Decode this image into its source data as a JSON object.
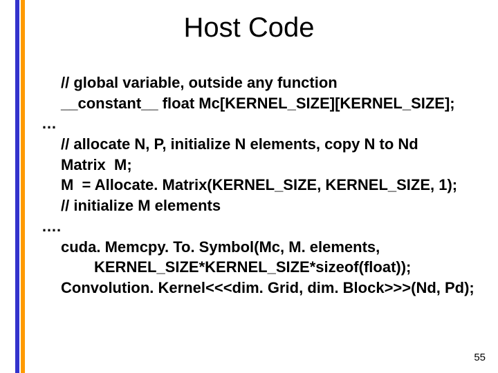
{
  "title": "Host Code",
  "lines": {
    "l1": "// global variable, outside any function",
    "l2": "__constant__ float Mc[KERNEL_SIZE][KERNEL_SIZE];",
    "l3": "…",
    "l4": "// allocate N, P, initialize N elements, copy N to Nd",
    "l5": "Matrix  M;",
    "l6": "M  = Allocate. Matrix(KERNEL_SIZE, KERNEL_SIZE, 1);",
    "l7": "// initialize M elements",
    "l8": "….",
    "l9": "cuda. Memcpy. To. Symbol(Mc, M. elements,",
    "l10": "KERNEL_SIZE*KERNEL_SIZE*sizeof(float));",
    "l11": "Convolution. Kernel<<<dim. Grid, dim. Block>>>(Nd, Pd);"
  },
  "pagenum": "55"
}
